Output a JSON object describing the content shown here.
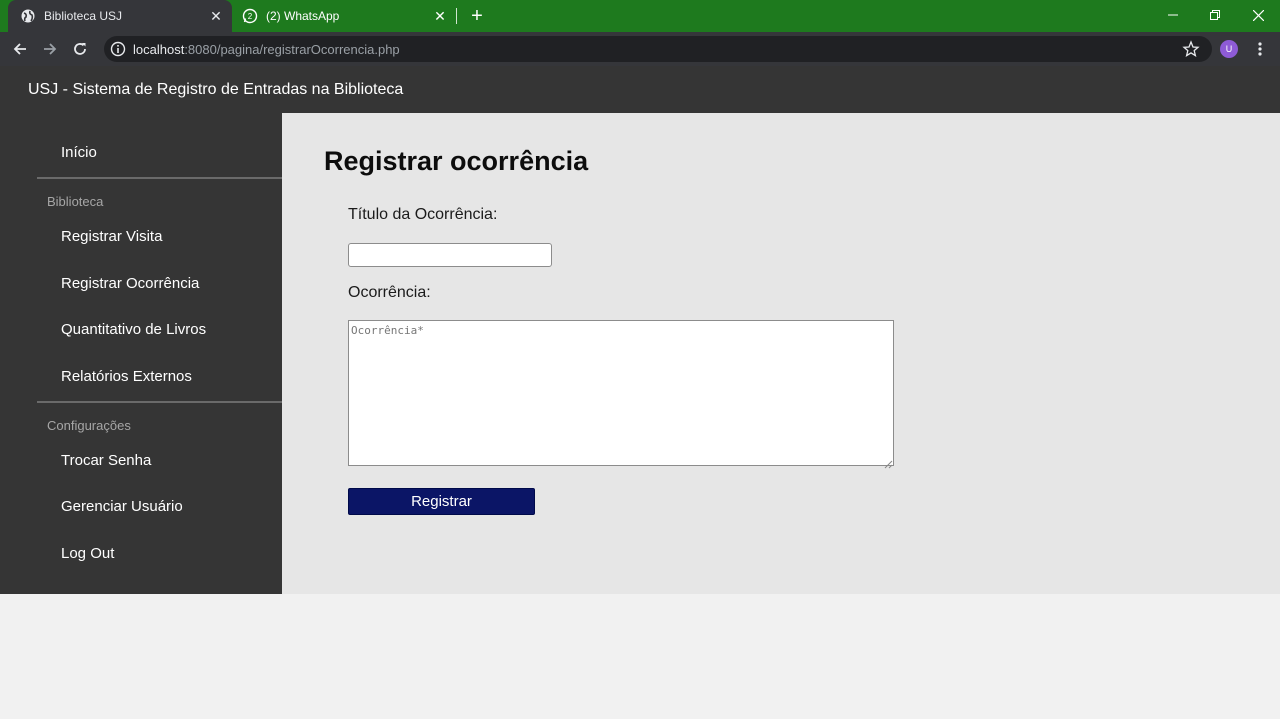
{
  "browser": {
    "tabs": [
      {
        "title": "Biblioteca USJ",
        "active": true,
        "icon": "globe-icon"
      },
      {
        "title": "(2) WhatsApp",
        "active": false,
        "icon": "whatsapp-icon"
      }
    ],
    "url_host": "localhost",
    "url_path": ":8080/pagina/registrarOcorrencia.php",
    "avatar_letter": "U",
    "colors": {
      "tabstrip": "#1e7a1e",
      "toolbar": "#35363a",
      "avatar": "#8e5bd6"
    }
  },
  "app": {
    "title": "USJ - Sistema de Registro de Entradas na Biblioteca",
    "colors": {
      "header": "#353535",
      "content": "#e6e6e6",
      "button": "#0b1566"
    }
  },
  "sidebar": {
    "home": "Início",
    "section_library": "Biblioteca",
    "library_items": [
      "Registrar Visita",
      "Registrar Ocorrência",
      "Quantitativo de Livros",
      "Relatórios Externos"
    ],
    "section_settings": "Configurações",
    "settings_items": [
      "Trocar Senha",
      "Gerenciar Usuário",
      "Log Out"
    ]
  },
  "form": {
    "heading": "Registrar ocorrência",
    "title_label": "Título da Ocorrência:",
    "title_value": "",
    "occurrence_label": "Ocorrência:",
    "occurrence_placeholder": "Ocorrência*",
    "submit_label": "Registrar"
  }
}
